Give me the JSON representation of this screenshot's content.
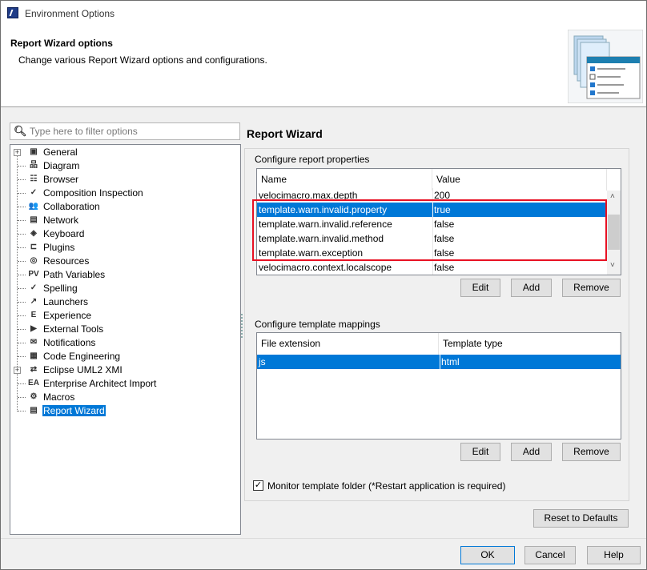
{
  "window": {
    "title": "Environment Options"
  },
  "header": {
    "title": "Report Wizard options",
    "description": "Change various Report Wizard options and configurations."
  },
  "filter": {
    "placeholder": "Type here to filter options"
  },
  "tree": {
    "items": [
      {
        "label": "General",
        "icon": "general-icon",
        "glyph": "▣",
        "expandable": true
      },
      {
        "label": "Diagram",
        "icon": "diagram-icon",
        "glyph": "品"
      },
      {
        "label": "Browser",
        "icon": "browser-icon",
        "glyph": "☷"
      },
      {
        "label": "Composition Inspection",
        "icon": "composition-inspection-icon",
        "glyph": "✓"
      },
      {
        "label": "Collaboration",
        "icon": "collaboration-icon",
        "glyph": "👥"
      },
      {
        "label": "Network",
        "icon": "network-icon",
        "glyph": "▤"
      },
      {
        "label": "Keyboard",
        "icon": "keyboard-icon",
        "glyph": "◈"
      },
      {
        "label": "Plugins",
        "icon": "plugins-icon",
        "glyph": "⊏"
      },
      {
        "label": "Resources",
        "icon": "resources-icon",
        "glyph": "◎"
      },
      {
        "label": "Path Variables",
        "icon": "path-variables-icon",
        "glyph": "PV"
      },
      {
        "label": "Spelling",
        "icon": "spelling-icon",
        "glyph": "✓"
      },
      {
        "label": "Launchers",
        "icon": "launchers-icon",
        "glyph": "↗"
      },
      {
        "label": "Experience",
        "icon": "experience-icon",
        "glyph": "E"
      },
      {
        "label": "External Tools",
        "icon": "external-tools-icon",
        "glyph": "▶"
      },
      {
        "label": "Notifications",
        "icon": "envelope-icon",
        "glyph": "✉"
      },
      {
        "label": "Code Engineering",
        "icon": "code-engineering-icon",
        "glyph": "▦"
      },
      {
        "label": "Eclipse UML2 XMI",
        "icon": "eclipse-uml2-icon",
        "glyph": "⇄",
        "expandable": true
      },
      {
        "label": "Enterprise Architect Import",
        "icon": "ea-import-icon",
        "glyph": "EA"
      },
      {
        "label": "Macros",
        "icon": "gear-icon",
        "glyph": "⚙"
      },
      {
        "label": "Report Wizard",
        "icon": "report-wizard-icon",
        "glyph": "▤",
        "selected": true
      }
    ]
  },
  "main": {
    "title": "Report Wizard",
    "properties": {
      "label": "Configure report properties",
      "columns": [
        "Name",
        "Value"
      ],
      "rows": [
        {
          "name": "velocimacro.max.depth",
          "value": "200"
        },
        {
          "name": "template.warn.invalid.property",
          "value": "true",
          "selected": true
        },
        {
          "name": "template.warn.invalid.reference",
          "value": "false"
        },
        {
          "name": "template.warn.invalid.method",
          "value": "false"
        },
        {
          "name": "template.warn.exception",
          "value": "false"
        },
        {
          "name": "velocimacro.context.localscope",
          "value": "false"
        }
      ],
      "buttons": {
        "edit": "Edit",
        "add": "Add",
        "remove": "Remove"
      }
    },
    "mappings": {
      "label": "Configure template mappings",
      "columns": [
        "File extension",
        "Template type"
      ],
      "rows": [
        {
          "ext": "js",
          "type": "html",
          "selected": true
        }
      ],
      "buttons": {
        "edit": "Edit",
        "add": "Add",
        "remove": "Remove"
      }
    },
    "monitor": {
      "label": "Monitor template folder (*Restart application is required)",
      "checked": true
    },
    "reset_label": "Reset to Defaults"
  },
  "footer": {
    "ok": "OK",
    "cancel": "Cancel",
    "help": "Help"
  },
  "colors": {
    "selection": "#0078d7",
    "highlight_box": "#e81123"
  }
}
